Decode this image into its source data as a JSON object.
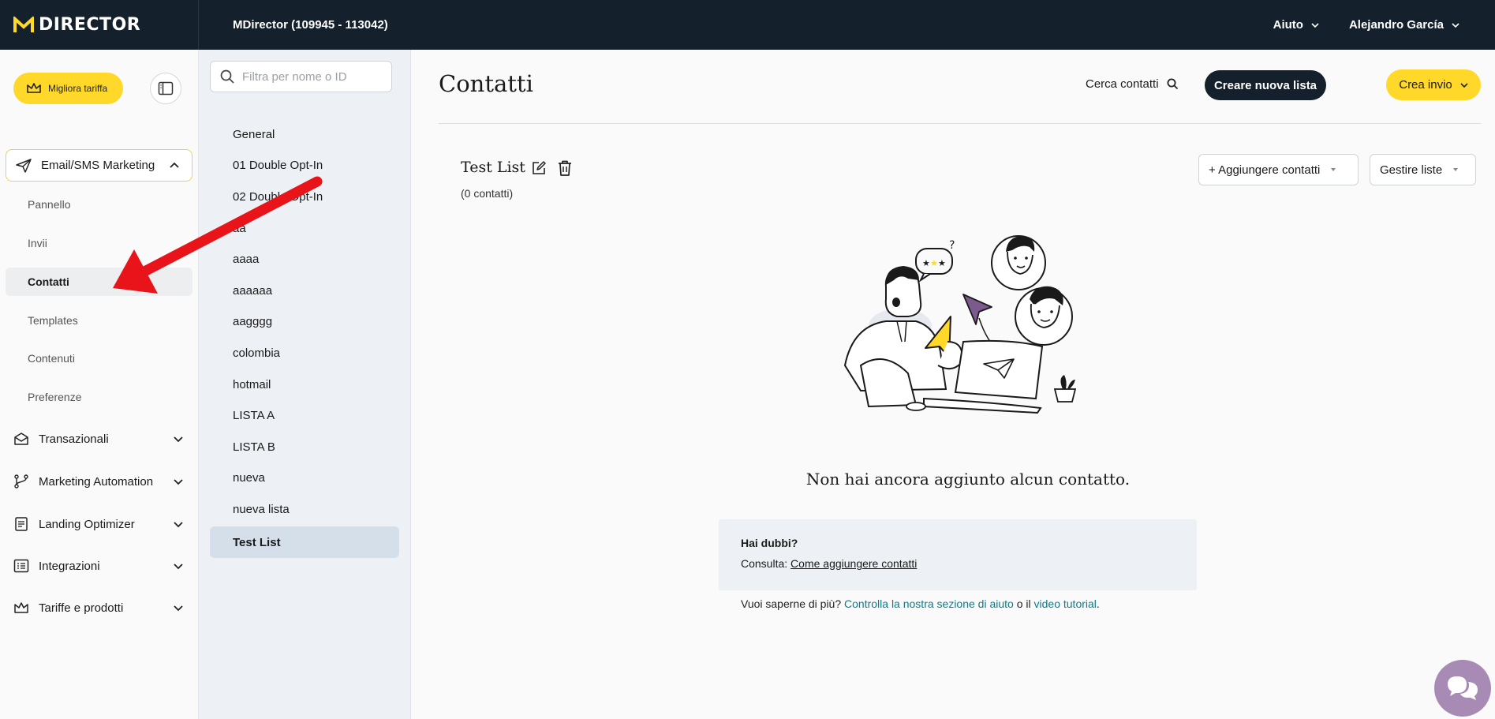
{
  "topbar": {
    "logo_text": "DIRECTOR",
    "account": "MDirector (109945 - 113042)",
    "help_menu": "Aiuto",
    "user_menu": "Alejandro García"
  },
  "sidebar": {
    "upgrade_label": "Migliora tariffa",
    "email_section": {
      "label": "Email/SMS Marketing",
      "items": [
        "Pannello",
        "Invii",
        "Contatti",
        "Templates",
        "Contenuti",
        "Preferenze"
      ],
      "active": "Contatti"
    },
    "groups": [
      "Transazionali",
      "Marketing Automation",
      "Landing Optimizer",
      "Integrazioni",
      "Tariffe e prodotti"
    ]
  },
  "lists": {
    "filter_placeholder": "Filtra per nome o ID",
    "items": [
      "General",
      "01 Double Opt-In",
      "02 Double Opt-In",
      "aa",
      "aaaa",
      "aaaaaa",
      "aagggg",
      "colombia",
      "hotmail",
      "LISTA A",
      "LISTA B",
      "nueva",
      "nueva lista",
      "Test List"
    ],
    "active": "Test List"
  },
  "main": {
    "title": "Contatti",
    "search_label": "Cerca contatti",
    "create_list_label": "Creare nuova lista",
    "create_send_label": "Crea invio",
    "list_name": "Test List",
    "contact_count": "(0 contatti)",
    "add_contacts_label": "+ Aggiungere contatti",
    "manage_lists_label": "Gestire liste",
    "empty_message": "Non hai ancora aggiunto alcun contatto.",
    "help": {
      "heading": "Hai dubbi?",
      "prefix": "Consulta:",
      "link": "Come aggiungere contatti"
    },
    "more": {
      "prefix": "Vuoi saperne di più?",
      "link1": "Controlla la nostra sezione di aiuto",
      "middle": "o il",
      "link2": "video tutorial",
      "suffix": "."
    }
  },
  "colors": {
    "topbar": "#14202b",
    "accent_yellow": "#ffd829",
    "link_teal": "#0b7d8a",
    "chat_purple": "#a88bb5",
    "annotation_red": "#e8141a"
  }
}
